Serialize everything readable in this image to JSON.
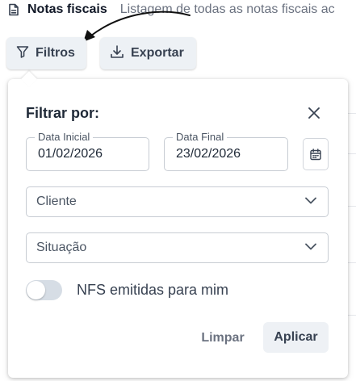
{
  "header": {
    "title": "Notas fiscais",
    "subtitle": "Listagem de todas as notas fiscais ac",
    "icon": "document-icon"
  },
  "toolbar": {
    "filter_label": "Filtros",
    "filter_icon": "filter-icon",
    "export_label": "Exportar",
    "export_icon": "download-icon"
  },
  "filter_panel": {
    "title": "Filtrar por:",
    "close_icon": "close-icon",
    "date_start": {
      "label": "Data Inicial",
      "value": "01/02/2026"
    },
    "date_end": {
      "label": "Data Final",
      "value": "23/02/2026"
    },
    "calendar_icon": "calendar-icon",
    "client_select": {
      "placeholder": "Cliente"
    },
    "status_select": {
      "placeholder": "Situação"
    },
    "toggle": {
      "label": "NFS emitidas para mim",
      "checked": false
    },
    "clear_label": "Limpar",
    "apply_label": "Aplicar"
  },
  "colors": {
    "button_bg": "#edf1f5",
    "text_primary": "#1f2937",
    "text_muted": "#6b7280",
    "border": "#c7ccd3",
    "toggle_off": "#d6dde5"
  }
}
